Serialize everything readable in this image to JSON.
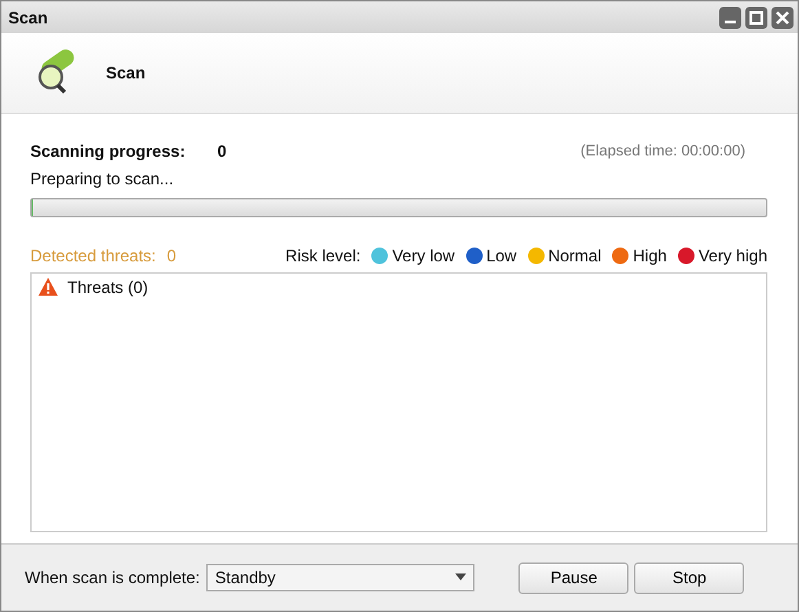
{
  "window": {
    "title": "Scan"
  },
  "header": {
    "title": "Scan"
  },
  "progress": {
    "label": "Scanning progress:",
    "count": "0",
    "elapsed": "(Elapsed time: 00:00:00)",
    "status": "Preparing to scan...",
    "level": 0
  },
  "threats": {
    "label": "Detected threats:",
    "count": "0"
  },
  "risk_legend": {
    "label": "Risk level:",
    "levels": [
      {
        "label": "Very low",
        "color": "#4fc3dc"
      },
      {
        "label": "Low",
        "color": "#1f5fc8"
      },
      {
        "label": "Normal",
        "color": "#f4b800"
      },
      {
        "label": "High",
        "color": "#ee6a12"
      },
      {
        "label": "Very high",
        "color": "#d8182a"
      }
    ]
  },
  "threat_list": [
    {
      "label": "Threats (0)"
    }
  ],
  "footer": {
    "label": "When scan is complete:",
    "value": "Standby",
    "buttons": [
      "Pause",
      "Stop"
    ]
  }
}
